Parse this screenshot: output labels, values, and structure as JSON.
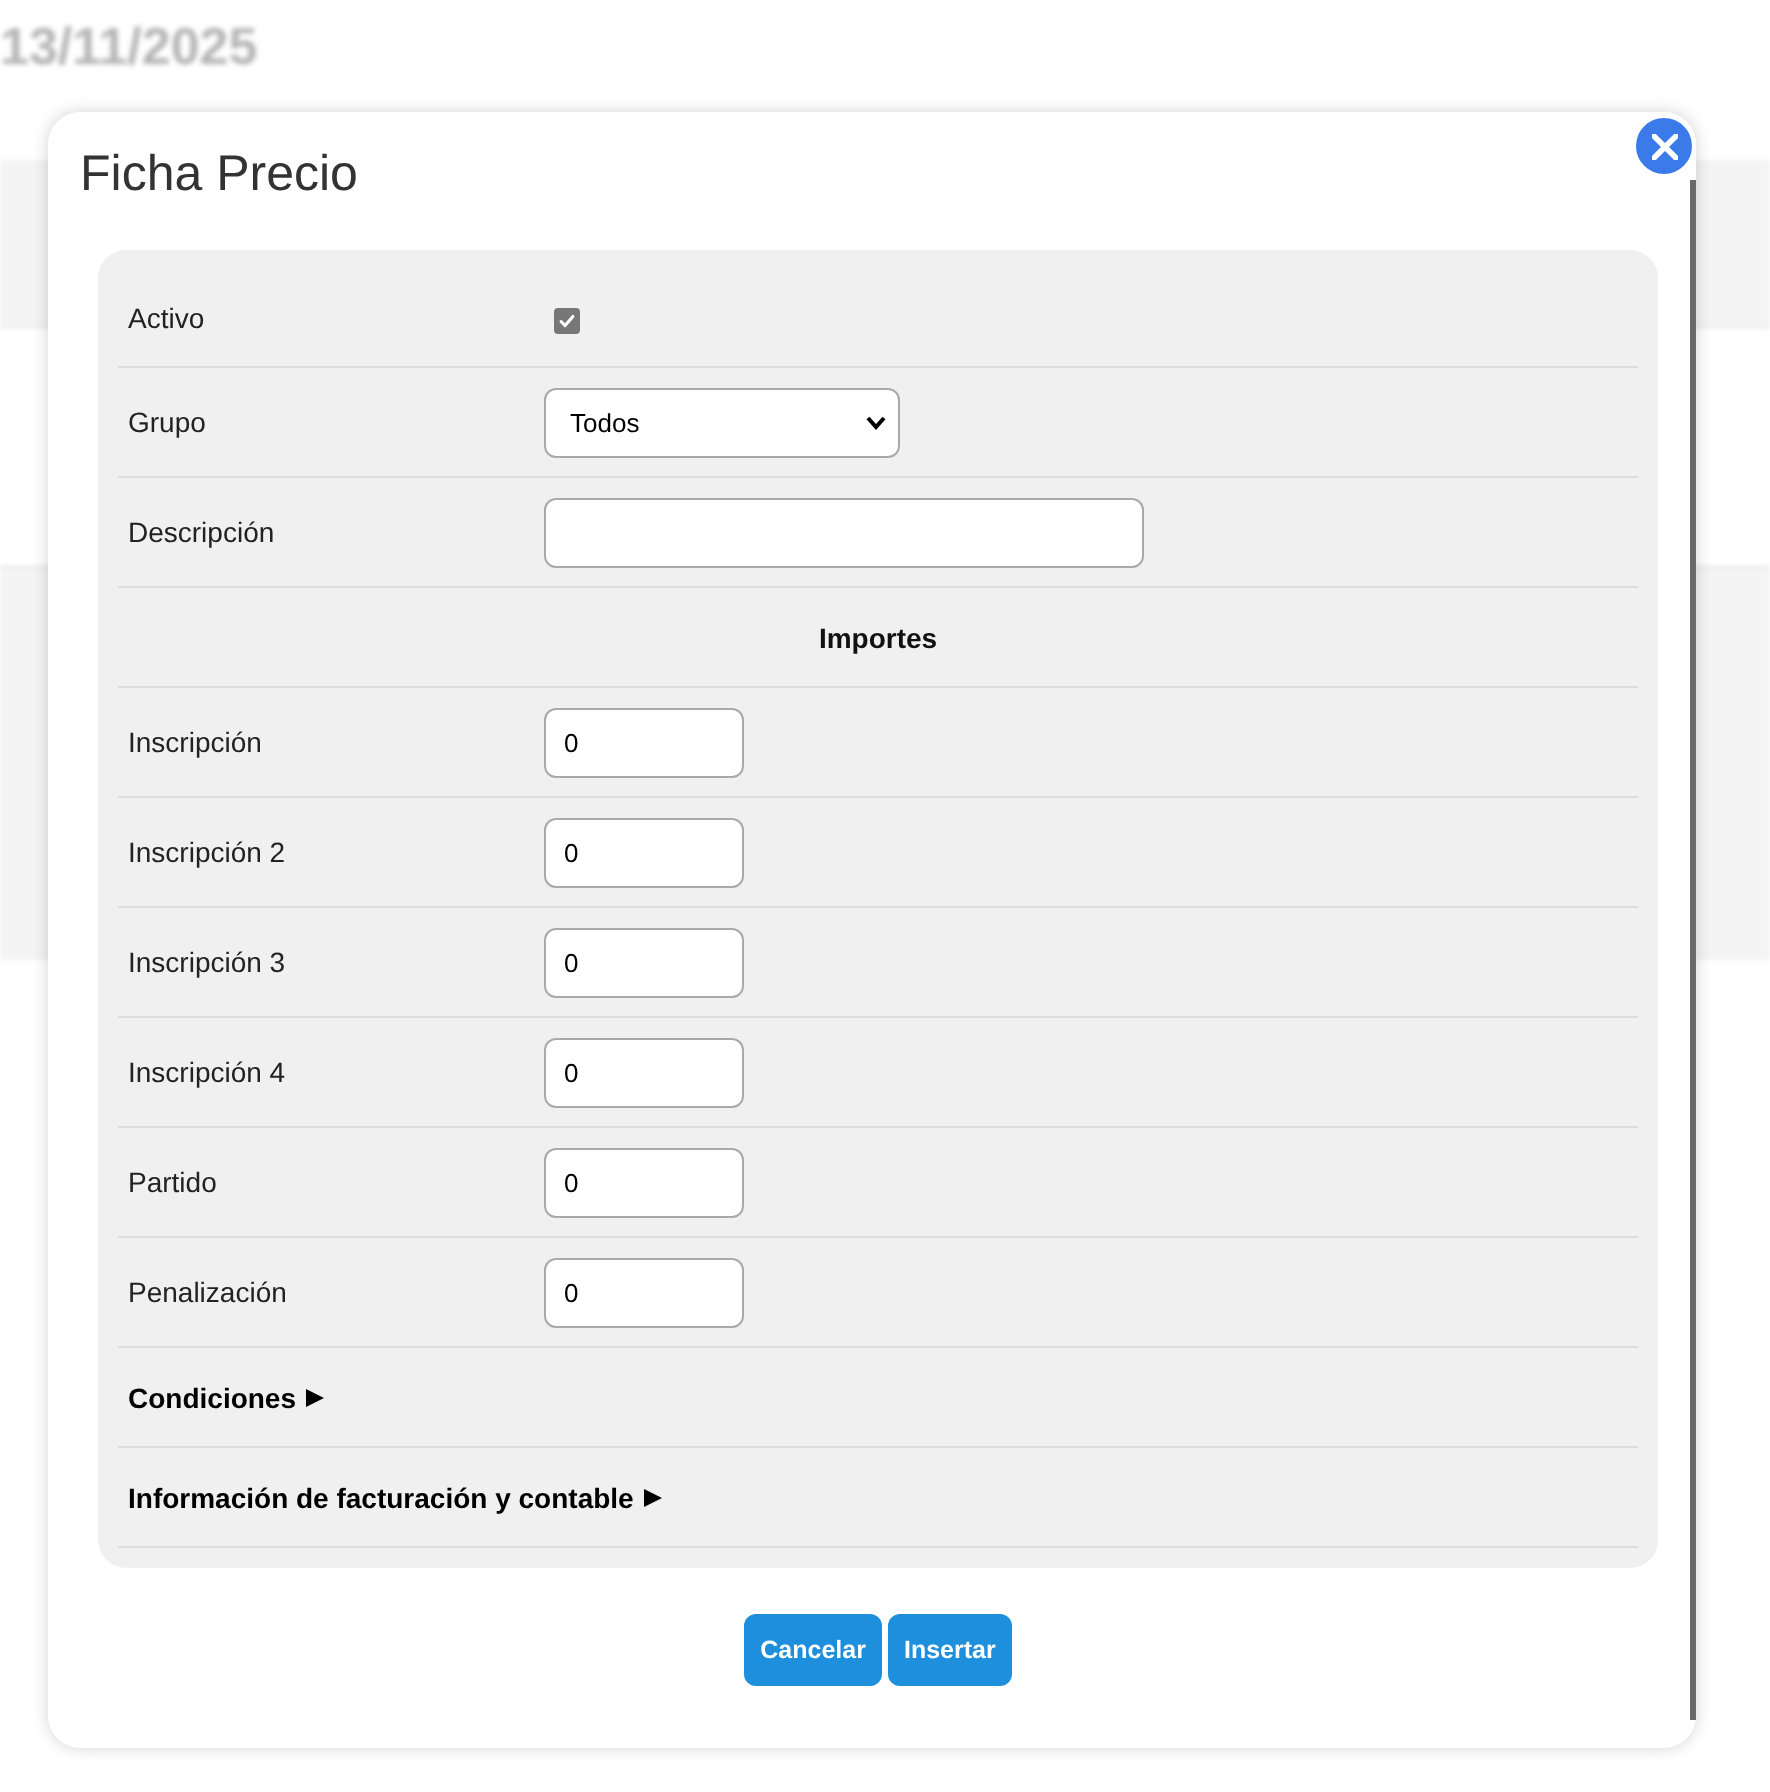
{
  "background": {
    "date": "13/11/2025"
  },
  "dialog": {
    "title": "Ficha Precio",
    "rows": [
      {
        "kind": "checkbox",
        "label": "Activo",
        "checked": true,
        "disabled": true
      },
      {
        "kind": "select",
        "label": "Grupo",
        "value": "Todos"
      },
      {
        "kind": "text",
        "label": "Descripción"
      },
      {
        "kind": "heading",
        "label": "Importes"
      },
      {
        "kind": "number",
        "label": "Inscripción",
        "value": "0"
      },
      {
        "kind": "number",
        "label": "Inscripción 2",
        "value": "0"
      },
      {
        "kind": "number",
        "label": "Inscripción 3",
        "value": "0"
      },
      {
        "kind": "number",
        "label": "Inscripción 4",
        "value": "0"
      },
      {
        "kind": "number",
        "label": "Partido",
        "value": "0"
      },
      {
        "kind": "number",
        "label": "Penalización",
        "value": "0"
      },
      {
        "kind": "section",
        "label": "Condiciones",
        "expanded": false
      },
      {
        "kind": "section",
        "label": "Información de facturación y contable",
        "expanded": false
      }
    ],
    "buttons": [
      {
        "label": "Cancelar"
      },
      {
        "label": "Insertar"
      }
    ]
  }
}
